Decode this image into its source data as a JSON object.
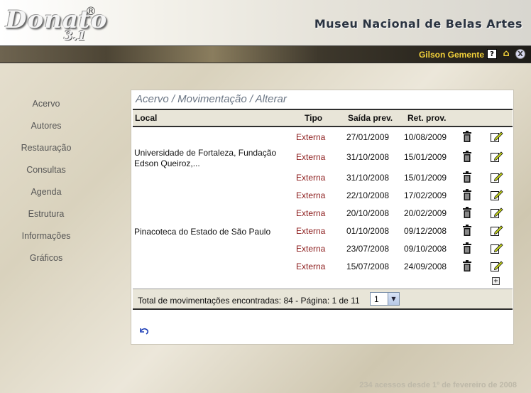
{
  "app": {
    "logo_name": "Donato",
    "logo_version": "3.1",
    "logo_reg": "®",
    "museum": "Museu Nacional de Belas Artes"
  },
  "user": {
    "name": "Gilson Gemente",
    "help_label": "?",
    "close_label": "X"
  },
  "sidebar": {
    "items": [
      {
        "label": "Acervo"
      },
      {
        "label": "Autores"
      },
      {
        "label": "Restauração"
      },
      {
        "label": "Consultas"
      },
      {
        "label": "Agenda"
      },
      {
        "label": "Estrutura"
      },
      {
        "label": "Informações"
      },
      {
        "label": "Gráficos"
      }
    ]
  },
  "panel": {
    "title": "Acervo / Movimentação / Alterar",
    "columns": {
      "local": "Local",
      "tipo": "Tipo",
      "saida": "Saída prev.",
      "ret": "Ret. prov."
    },
    "groups": [
      {
        "local": "Universidade de Fortaleza, Fundação Edson Queiroz,..."
      },
      {
        "local": "Pinacoteca do Estado de São Paulo"
      }
    ],
    "rows": [
      {
        "tipo": "Externa",
        "saida": "27/01/2009",
        "ret": "10/08/2009"
      },
      {
        "tipo": "Externa",
        "saida": "31/10/2008",
        "ret": "15/01/2009"
      },
      {
        "tipo": "Externa",
        "saida": "31/10/2008",
        "ret": "15/01/2009"
      },
      {
        "tipo": "Externa",
        "saida": "22/10/2008",
        "ret": "17/02/2009"
      },
      {
        "tipo": "Externa",
        "saida": "20/10/2008",
        "ret": "20/02/2009"
      },
      {
        "tipo": "Externa",
        "saida": "01/10/2008",
        "ret": "09/12/2008"
      },
      {
        "tipo": "Externa",
        "saida": "23/07/2008",
        "ret": "09/10/2008"
      },
      {
        "tipo": "Externa",
        "saida": "15/07/2008",
        "ret": "24/09/2008"
      }
    ],
    "footer": {
      "total_text": "Total de movimentações encontradas: 84 - Página: 1 de 11",
      "page_selected": "1"
    },
    "add_label": "+"
  },
  "footer": {
    "access_text": "234 acessos desde 1º de fevereiro de 2008"
  },
  "colors": {
    "accent_user": "#f3d23a",
    "tipo": "#8b1a1a",
    "title": "#6a7584"
  }
}
